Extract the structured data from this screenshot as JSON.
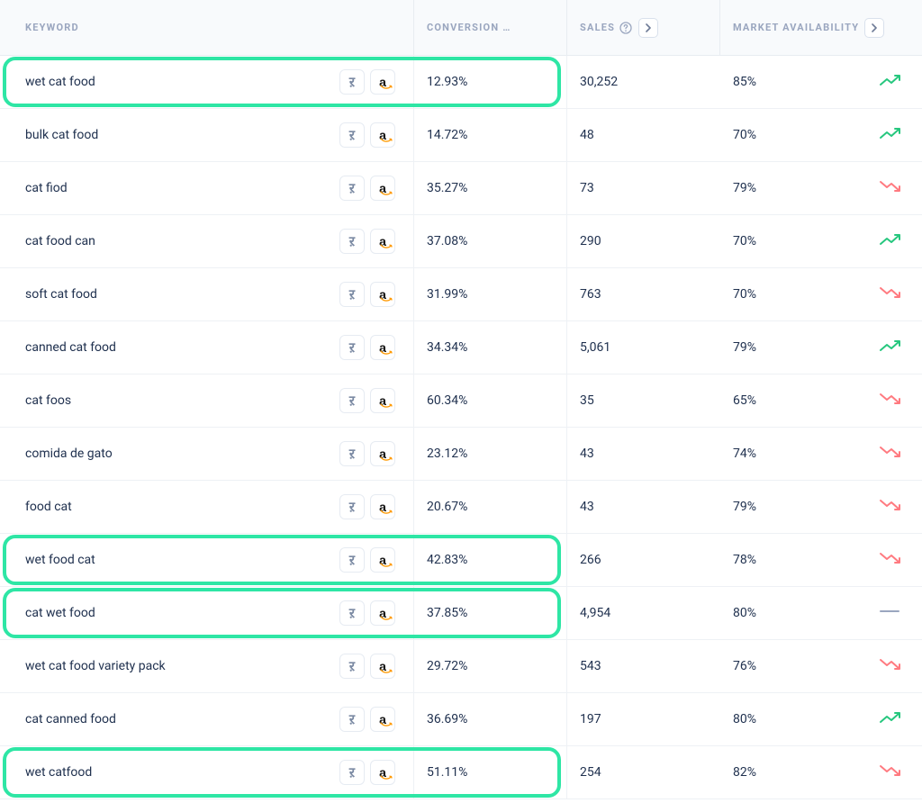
{
  "headers": {
    "keyword": "KEYWORD",
    "conversion": "CONVERSION …",
    "sales": "SALES",
    "market": "MARKET AVAILABILITY"
  },
  "rows": [
    {
      "keyword": "wet cat food",
      "conversion": "12.93%",
      "sales": "30,252",
      "market": "85%",
      "trend": "up",
      "highlight": true
    },
    {
      "keyword": "bulk cat food",
      "conversion": "14.72%",
      "sales": "48",
      "market": "70%",
      "trend": "up",
      "highlight": false
    },
    {
      "keyword": "cat fiod",
      "conversion": "35.27%",
      "sales": "73",
      "market": "79%",
      "trend": "down",
      "highlight": false
    },
    {
      "keyword": "cat food can",
      "conversion": "37.08%",
      "sales": "290",
      "market": "70%",
      "trend": "up",
      "highlight": false
    },
    {
      "keyword": "soft cat food",
      "conversion": "31.99%",
      "sales": "763",
      "market": "70%",
      "trend": "down",
      "highlight": false
    },
    {
      "keyword": "canned cat food",
      "conversion": "34.34%",
      "sales": "5,061",
      "market": "79%",
      "trend": "up",
      "highlight": false
    },
    {
      "keyword": "cat foos",
      "conversion": "60.34%",
      "sales": "35",
      "market": "65%",
      "trend": "down",
      "highlight": false
    },
    {
      "keyword": "comida de gato",
      "conversion": "23.12%",
      "sales": "43",
      "market": "74%",
      "trend": "down",
      "highlight": false
    },
    {
      "keyword": "food cat",
      "conversion": "20.67%",
      "sales": "43",
      "market": "79%",
      "trend": "down",
      "highlight": false
    },
    {
      "keyword": "wet food cat",
      "conversion": "42.83%",
      "sales": "266",
      "market": "78%",
      "trend": "down",
      "highlight": true
    },
    {
      "keyword": "cat wet food",
      "conversion": "37.85%",
      "sales": "4,954",
      "market": "80%",
      "trend": "flat",
      "highlight": true
    },
    {
      "keyword": "wet cat food variety pack",
      "conversion": "29.72%",
      "sales": "543",
      "market": "76%",
      "trend": "down",
      "highlight": false
    },
    {
      "keyword": "cat canned food",
      "conversion": "36.69%",
      "sales": "197",
      "market": "80%",
      "trend": "up",
      "highlight": false
    },
    {
      "keyword": "wet catfood",
      "conversion": "51.11%",
      "sales": "254",
      "market": "82%",
      "trend": "down",
      "highlight": true
    }
  ]
}
